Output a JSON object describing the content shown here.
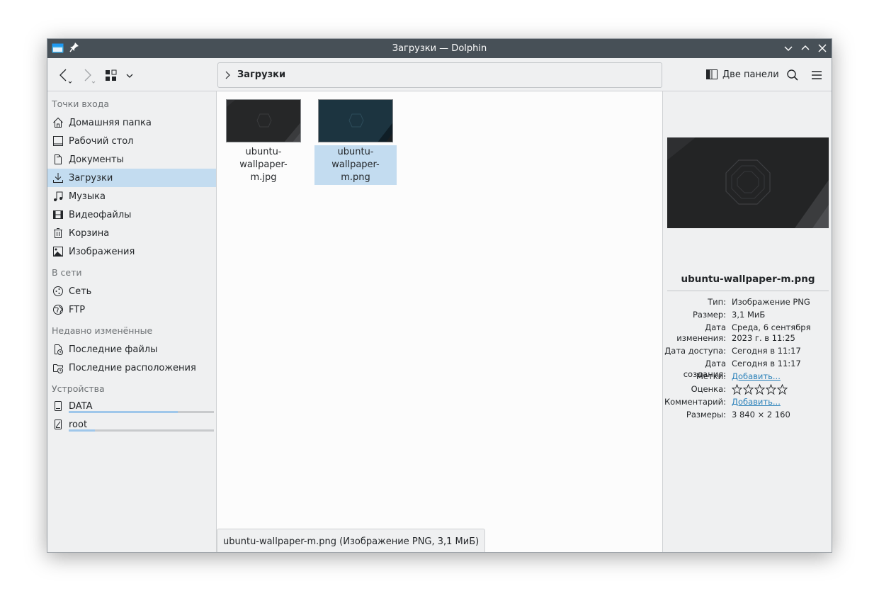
{
  "window": {
    "title": "Загрузки — Dolphin"
  },
  "toolbar": {
    "breadcrumb": "Загрузки",
    "split_label": "Две панели"
  },
  "sidebar": {
    "groups": [
      {
        "title": "Точки входа",
        "items": [
          "Домашняя папка",
          "Рабочий стол",
          "Документы",
          "Загрузки",
          "Музыка",
          "Видеофайлы",
          "Корзина",
          "Изображения"
        ]
      },
      {
        "title": "В сети",
        "items": [
          "Сеть",
          "FTP"
        ]
      },
      {
        "title": "Недавно изменённые",
        "items": [
          "Последние файлы",
          "Последние расположения"
        ]
      },
      {
        "title": "Устройства",
        "items": [
          "DATA",
          "root"
        ]
      }
    ],
    "selected": "Загрузки",
    "device_usage": {
      "DATA": 0.75,
      "root": 0.18
    }
  },
  "files": [
    {
      "name_line1": "ubuntu-wallpaper-",
      "name_line2": "m.jpg",
      "selected": false
    },
    {
      "name_line1": "ubuntu-wallpaper-",
      "name_line2": "m.png",
      "selected": true
    }
  ],
  "statusbar": {
    "text": "ubuntu-wallpaper-m.png (Изображение PNG, 3,1 МиБ)"
  },
  "info": {
    "filename": "ubuntu-wallpaper-m.png",
    "rows": [
      {
        "key": "Тип:",
        "value": "Изображение PNG"
      },
      {
        "key": "Размер:",
        "value": "3,1 МиБ"
      },
      {
        "key": "Дата изменения:",
        "value": "Среда, 6 сентября 2023 г. в 11:25"
      },
      {
        "key": "Дата доступа:",
        "value": "Сегодня в 11:17"
      },
      {
        "key": "Дата создания:",
        "value": "Сегодня в 11:17"
      },
      {
        "key": "Метки:",
        "value": "Добавить..."
      },
      {
        "key": "Оценка:",
        "value": ""
      },
      {
        "key": "Комментарий:",
        "value": "Добавить..."
      },
      {
        "key": "Размеры:",
        "value": "3 840 × 2 160"
      }
    ],
    "rating_stars": 0
  },
  "colors": {
    "selection": "#c3dcf0",
    "titlebar": "#475057",
    "link": "#2980b9"
  }
}
